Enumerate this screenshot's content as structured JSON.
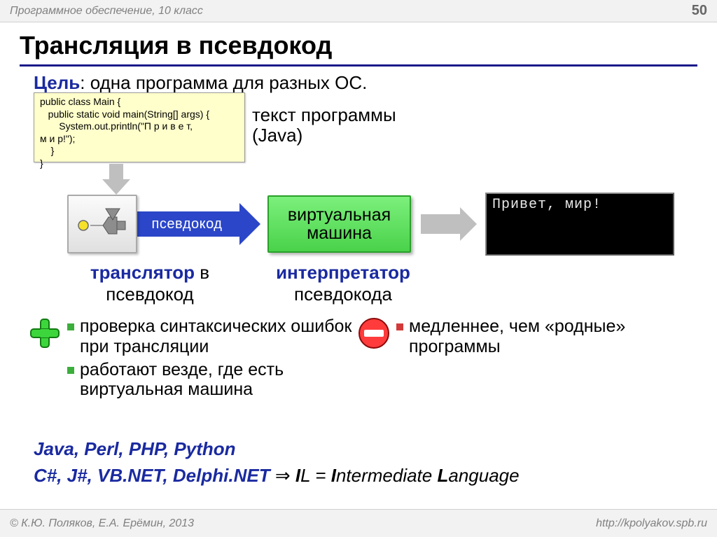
{
  "header": {
    "subject": "Программное обеспечение, 10 класс",
    "page": "50"
  },
  "title": "Трансляция в псевдокод",
  "goal": {
    "label": "Цель",
    "text": ": одна программа для разных ОС."
  },
  "code": {
    "lines": "public class Main {\n   public static void main(String[] args) {\n       System.out.println(\"П р и в е т,\nм и р!\");\n    }\n}",
    "caption1": "текст программы",
    "caption2": "(Java)"
  },
  "flow": {
    "pseudo_label": "псевдокод",
    "vm_line1": "виртуальная",
    "vm_line2": "машина",
    "console_output": "Привет, мир!"
  },
  "captions": {
    "translator_bold": "транслятор",
    "translator_rest": " в",
    "translator_sub": "псевдокод",
    "interpreter_bold": "интерпретатор",
    "interpreter_sub": "псевдокода"
  },
  "pros": [
    "проверка синтаксических ошибок при трансляции",
    "работают везде, где есть виртуальная машина"
  ],
  "cons": [
    "медленнее, чем «родные» программы"
  ],
  "langs": {
    "line1": "Java, Perl, PHP, Python",
    "line2_blue": "C#, J#, VB.NET, Delphi.NET",
    "il_I": "I",
    "il_rest1": "L = ",
    "il_I2": "I",
    "il_mid": "ntermediate ",
    "il_L": "L",
    "il_end": "anguage"
  },
  "footer": {
    "copyright": "© К.Ю. Поляков, Е.А. Ерёмин, 2013",
    "url": "http://kpolyakov.spb.ru"
  }
}
